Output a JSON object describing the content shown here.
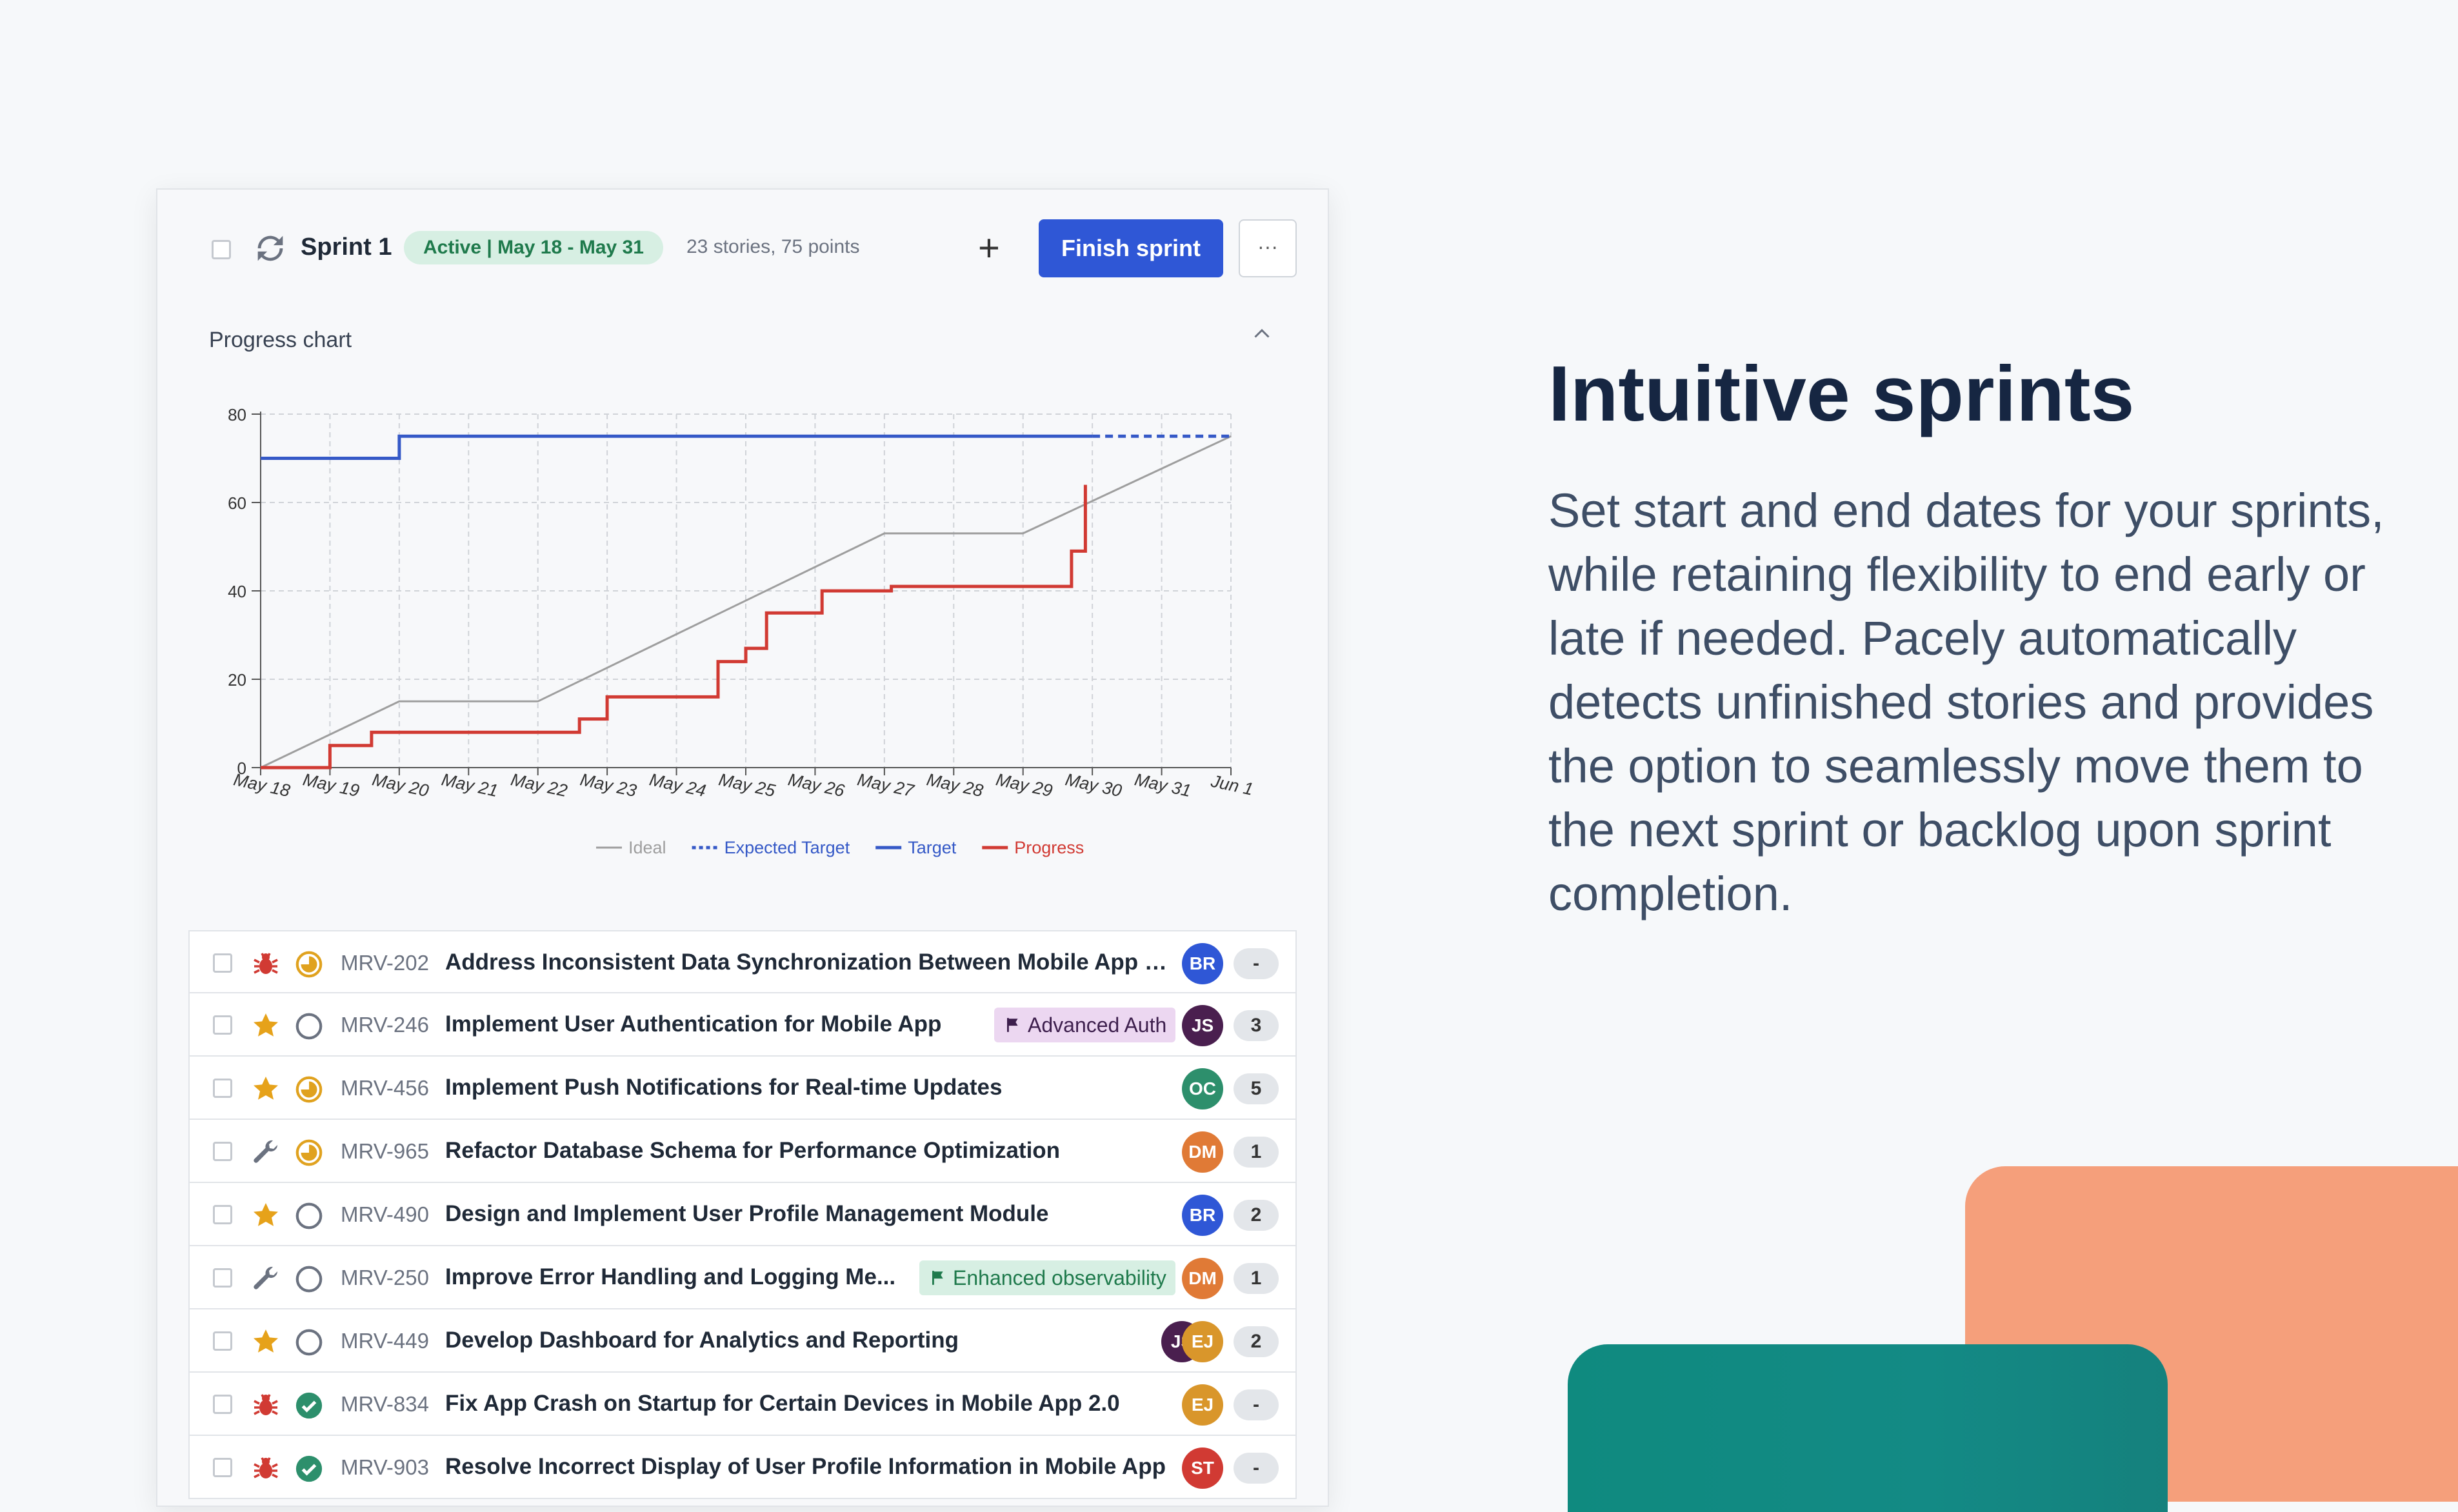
{
  "colors": {
    "finish_button": "#2f57d6",
    "ideal_line": "#9e9e9e",
    "target_line": "#3559c7",
    "progress_line": "#d13a33",
    "headline": "#162642",
    "deco_orange": "#f59f7b",
    "deco_teal": "#0f8a7f"
  },
  "sprint": {
    "title": "Sprint 1",
    "status_badge": "Active  |  May 18 - May 31",
    "meta": "23 stories, 75 points",
    "add_icon": "plus-icon",
    "finish_label": "Finish sprint",
    "more_label": "···"
  },
  "chart_section": {
    "title": "Progress chart",
    "toggle_icon": "chevron-up-icon"
  },
  "chart_data": {
    "type": "line",
    "title": "",
    "xlabel": "",
    "ylabel": "",
    "x": [
      "May 18",
      "May 19",
      "May 20",
      "May 21",
      "May 22",
      "May 23",
      "May 24",
      "May 25",
      "May 26",
      "May 27",
      "May 28",
      "May 29",
      "May 30",
      "May 31",
      "Jun 1"
    ],
    "ylim": [
      0,
      80
    ],
    "yticks": [
      0,
      20,
      40,
      60,
      80
    ],
    "grid": true,
    "legend_position": "bottom",
    "series": [
      {
        "name": "Ideal",
        "style": "solid",
        "color": "#9e9e9e",
        "points": [
          [
            "May 18",
            0
          ],
          [
            "May 20",
            15
          ],
          [
            "May 22",
            15
          ],
          [
            "May 27",
            53
          ],
          [
            "May 29",
            53
          ],
          [
            "Jun 1",
            75
          ]
        ]
      },
      {
        "name": "Expected Target",
        "style": "dashed",
        "color": "#3559c7",
        "points": [
          [
            "May 30",
            75
          ],
          [
            "Jun 1",
            75
          ]
        ]
      },
      {
        "name": "Target",
        "style": "solid",
        "color": "#3559c7",
        "points": [
          [
            "May 18",
            70
          ],
          [
            "May 20",
            70
          ],
          [
            "May 20",
            75
          ],
          [
            "May 30",
            75
          ]
        ]
      },
      {
        "name": "Progress",
        "style": "step",
        "color": "#d13a33",
        "points": [
          [
            "May 18",
            0
          ],
          [
            "May 19",
            0
          ],
          [
            "May 19",
            5
          ],
          [
            "May 19.6",
            5
          ],
          [
            "May 19.6",
            8
          ],
          [
            "May 22.6",
            8
          ],
          [
            "May 22.6",
            11
          ],
          [
            "May 23",
            11
          ],
          [
            "May 23",
            16
          ],
          [
            "May 24.6",
            16
          ],
          [
            "May 24.6",
            24
          ],
          [
            "May 25",
            24
          ],
          [
            "May 25",
            27
          ],
          [
            "May 25.3",
            27
          ],
          [
            "May 25.3",
            35
          ],
          [
            "May 26.1",
            35
          ],
          [
            "May 26.1",
            40
          ],
          [
            "May 27.1",
            40
          ],
          [
            "May 27.1",
            41
          ],
          [
            "May 29.7",
            41
          ],
          [
            "May 29.7",
            49
          ],
          [
            "May 29.9",
            49
          ],
          [
            "May 29.9",
            64
          ]
        ]
      }
    ]
  },
  "stories": [
    {
      "type_icon": "bug-icon",
      "status_icon": "in-progress-icon",
      "id": "MRV-202",
      "title": "Address Inconsistent Data Synchronization Between Mobile App a...",
      "tag": "",
      "tag_icon": "",
      "tag_style": "",
      "assignees": [
        {
          "initials": "BR",
          "color": "#2f57d6"
        }
      ],
      "points": "-"
    },
    {
      "type_icon": "star-icon",
      "status_icon": "todo-icon",
      "id": "MRV-246",
      "title": "Implement User Authentication for Mobile App",
      "tag": "Advanced Auth",
      "tag_icon": "flag-icon",
      "tag_style": "purple",
      "assignees": [
        {
          "initials": "JS",
          "color": "#4a1f4f"
        }
      ],
      "points": "3"
    },
    {
      "type_icon": "star-icon",
      "status_icon": "in-progress-icon",
      "id": "MRV-456",
      "title": "Implement Push Notifications for Real-time Updates",
      "tag": "",
      "tag_icon": "",
      "tag_style": "",
      "assignees": [
        {
          "initials": "OC",
          "color": "#2d8f6c"
        }
      ],
      "points": "5"
    },
    {
      "type_icon": "wrench-icon",
      "status_icon": "in-progress-icon",
      "id": "MRV-965",
      "title": "Refactor Database Schema for Performance Optimization",
      "tag": "",
      "tag_icon": "",
      "tag_style": "",
      "assignees": [
        {
          "initials": "DM",
          "color": "#e07a36"
        }
      ],
      "points": "1"
    },
    {
      "type_icon": "star-icon",
      "status_icon": "todo-icon",
      "id": "MRV-490",
      "title": "Design and Implement User Profile Management Module",
      "tag": "",
      "tag_icon": "",
      "tag_style": "",
      "assignees": [
        {
          "initials": "BR",
          "color": "#2f57d6"
        }
      ],
      "points": "2"
    },
    {
      "type_icon": "wrench-icon",
      "status_icon": "todo-icon",
      "id": "MRV-250",
      "title": "Improve Error Handling and Logging Me...",
      "tag": "Enhanced observability",
      "tag_icon": "flag-icon",
      "tag_style": "green",
      "assignees": [
        {
          "initials": "DM",
          "color": "#e07a36"
        }
      ],
      "points": "1"
    },
    {
      "type_icon": "star-icon",
      "status_icon": "todo-icon",
      "id": "MRV-449",
      "title": "Develop Dashboard for Analytics and Reporting",
      "tag": "",
      "tag_icon": "",
      "tag_style": "",
      "assignees": [
        {
          "initials": "JS",
          "color": "#4a1f4f"
        },
        {
          "initials": "EJ",
          "color": "#d9962b"
        }
      ],
      "points": "2"
    },
    {
      "type_icon": "bug-icon",
      "status_icon": "done-icon",
      "id": "MRV-834",
      "title": "Fix App Crash on Startup for Certain Devices in Mobile App 2.0",
      "tag": "",
      "tag_icon": "",
      "tag_style": "",
      "assignees": [
        {
          "initials": "EJ",
          "color": "#d9962b"
        }
      ],
      "points": "-"
    },
    {
      "type_icon": "bug-icon",
      "status_icon": "done-icon",
      "id": "MRV-903",
      "title": "Resolve Incorrect Display of User Profile Information in Mobile App",
      "tag": "",
      "tag_icon": "",
      "tag_style": "",
      "assignees": [
        {
          "initials": "ST",
          "color": "#d13a33"
        }
      ],
      "points": "-"
    }
  ],
  "marketing": {
    "headline": "Intuitive sprints",
    "body": "Set start and end dates for your sprints, while retaining flexibility to end early or late if needed. Pacely automatically detects unfinished stories and provides the option to seamlessly move them to the next sprint or backlog upon sprint completion."
  }
}
